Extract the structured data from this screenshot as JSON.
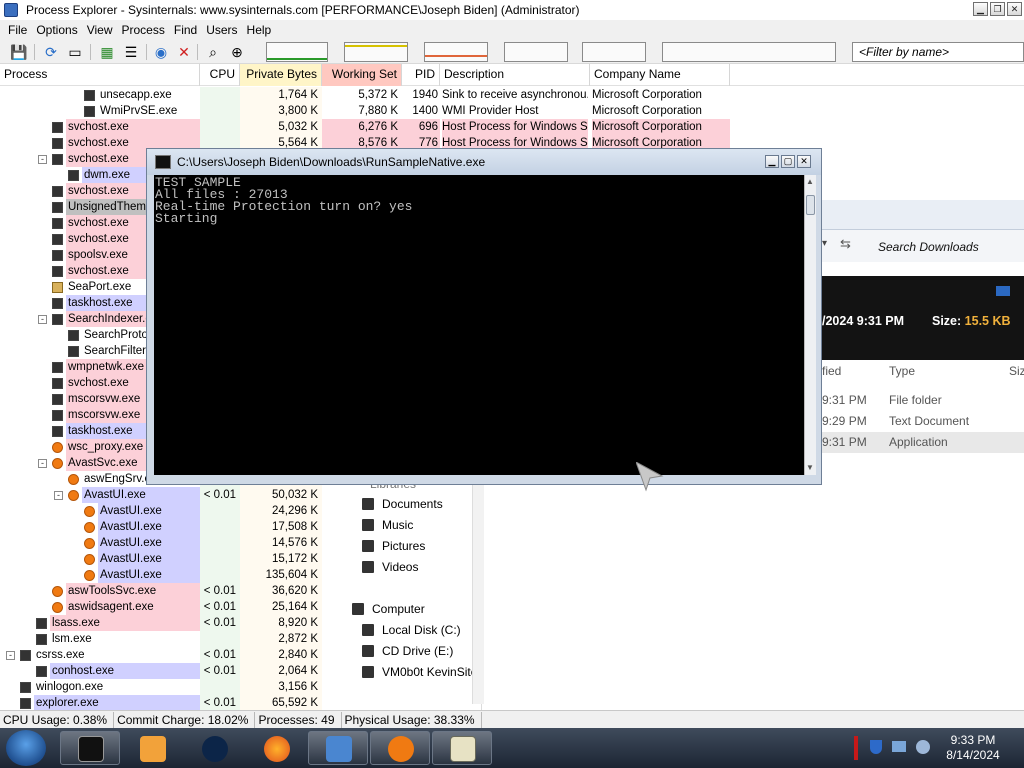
{
  "window": {
    "title": "Process Explorer - Sysinternals: www.sysinternals.com [PERFORMANCE\\Joseph Biden] (Administrator)"
  },
  "menu": [
    "File",
    "Options",
    "View",
    "Process",
    "Find",
    "Users",
    "Help"
  ],
  "toolbar": {
    "filter_placeholder": "<Filter by name>",
    "icons": [
      "save-icon",
      "refresh-icon",
      "window-icon",
      "chart-icon",
      "target-icon",
      "kill-icon",
      "find-icon",
      "crosshair-icon"
    ]
  },
  "columns": [
    "Process",
    "CPU",
    "Private Bytes",
    "Working Set",
    "PID",
    "Description",
    "Company Name"
  ],
  "processes": [
    {
      "name": "unsecapp.exe",
      "cpu": "",
      "pb": "1,764 K",
      "ws": "5,372 K",
      "pid": "1940",
      "desc": "Sink to receive asynchronou...",
      "co": "Microsoft Corporation"
    },
    {
      "name": "WmiPrvSE.exe",
      "cpu": "",
      "pb": "3,800 K",
      "ws": "7,880 K",
      "pid": "1400",
      "desc": "WMI Provider Host",
      "co": "Microsoft Corporation"
    },
    {
      "name": "svchost.exe",
      "cpu": "",
      "pb": "5,032 K",
      "ws": "6,276 K",
      "pid": "696",
      "desc": "Host Process for Windows S...",
      "co": "Microsoft Corporation"
    },
    {
      "name": "svchost.exe",
      "cpu": "",
      "pb": "5,564 K",
      "ws": "8,576 K",
      "pid": "776",
      "desc": "Host Process for Windows S...",
      "co": "Microsoft Corporation"
    },
    {
      "name": "svchost.exe",
      "cpu": "",
      "pb": "",
      "ws": "",
      "pid": "",
      "desc": "",
      "co": ""
    },
    {
      "name": "dwm.exe",
      "cpu": "",
      "pb": "",
      "ws": "",
      "pid": "",
      "desc": "",
      "co": ""
    },
    {
      "name": "svchost.exe",
      "cpu": "",
      "pb": "",
      "ws": "",
      "pid": "",
      "desc": "",
      "co": ""
    },
    {
      "name": "UnsignedThemes",
      "cpu": "",
      "pb": "",
      "ws": "",
      "pid": "",
      "desc": "",
      "co": ""
    },
    {
      "name": "svchost.exe",
      "cpu": "",
      "pb": "",
      "ws": "",
      "pid": "",
      "desc": "",
      "co": ""
    },
    {
      "name": "svchost.exe",
      "cpu": "",
      "pb": "",
      "ws": "",
      "pid": "",
      "desc": "",
      "co": ""
    },
    {
      "name": "spoolsv.exe",
      "cpu": "",
      "pb": "",
      "ws": "",
      "pid": "",
      "desc": "",
      "co": ""
    },
    {
      "name": "svchost.exe",
      "cpu": "",
      "pb": "",
      "ws": "",
      "pid": "",
      "desc": "",
      "co": ""
    },
    {
      "name": "SeaPort.exe",
      "cpu": "",
      "pb": "",
      "ws": "",
      "pid": "",
      "desc": "",
      "co": ""
    },
    {
      "name": "taskhost.exe",
      "cpu": "",
      "pb": "",
      "ws": "",
      "pid": "",
      "desc": "",
      "co": ""
    },
    {
      "name": "SearchIndexer.exe",
      "cpu": "",
      "pb": "",
      "ws": "",
      "pid": "",
      "desc": "",
      "co": ""
    },
    {
      "name": "SearchProtocolHost",
      "cpu": "",
      "pb": "",
      "ws": "",
      "pid": "",
      "desc": "",
      "co": ""
    },
    {
      "name": "SearchFilterHost",
      "cpu": "",
      "pb": "",
      "ws": "",
      "pid": "",
      "desc": "",
      "co": ""
    },
    {
      "name": "wmpnetwk.exe",
      "cpu": "",
      "pb": "",
      "ws": "",
      "pid": "",
      "desc": "",
      "co": ""
    },
    {
      "name": "svchost.exe",
      "cpu": "",
      "pb": "",
      "ws": "",
      "pid": "",
      "desc": "",
      "co": ""
    },
    {
      "name": "mscorsvw.exe",
      "cpu": "",
      "pb": "",
      "ws": "",
      "pid": "",
      "desc": "",
      "co": ""
    },
    {
      "name": "mscorsvw.exe",
      "cpu": "",
      "pb": "",
      "ws": "",
      "pid": "",
      "desc": "",
      "co": ""
    },
    {
      "name": "taskhost.exe",
      "cpu": "",
      "pb": "",
      "ws": "",
      "pid": "",
      "desc": "",
      "co": ""
    },
    {
      "name": "wsc_proxy.exe",
      "cpu": "",
      "pb": "",
      "ws": "",
      "pid": "",
      "desc": "",
      "co": ""
    },
    {
      "name": "AvastSvc.exe",
      "cpu": "",
      "pb": "",
      "ws": "",
      "pid": "",
      "desc": "",
      "co": ""
    },
    {
      "name": "aswEngSrv.exe",
      "cpu": "",
      "pb": "",
      "ws": "",
      "pid": "",
      "desc": "",
      "co": ""
    },
    {
      "name": "AvastUI.exe",
      "cpu": "< 0.01",
      "pb": "50,032 K",
      "ws": "",
      "pid": "",
      "desc": "",
      "co": ""
    },
    {
      "name": "AvastUI.exe",
      "cpu": "",
      "pb": "24,296 K",
      "ws": "",
      "pid": "",
      "desc": "",
      "co": ""
    },
    {
      "name": "AvastUI.exe",
      "cpu": "",
      "pb": "17,508 K",
      "ws": "",
      "pid": "",
      "desc": "",
      "co": ""
    },
    {
      "name": "AvastUI.exe",
      "cpu": "",
      "pb": "14,576 K",
      "ws": "",
      "pid": "",
      "desc": "",
      "co": ""
    },
    {
      "name": "AvastUI.exe",
      "cpu": "",
      "pb": "15,172 K",
      "ws": "",
      "pid": "",
      "desc": "",
      "co": ""
    },
    {
      "name": "AvastUI.exe",
      "cpu": "",
      "pb": "135,604 K",
      "ws": "",
      "pid": "",
      "desc": "",
      "co": ""
    },
    {
      "name": "aswToolsSvc.exe",
      "cpu": "< 0.01",
      "pb": "36,620 K",
      "ws": "",
      "pid": "",
      "desc": "",
      "co": ""
    },
    {
      "name": "aswidsagent.exe",
      "cpu": "< 0.01",
      "pb": "25,164 K",
      "ws": "",
      "pid": "",
      "desc": "",
      "co": ""
    },
    {
      "name": "lsass.exe",
      "cpu": "< 0.01",
      "pb": "8,920 K",
      "ws": "",
      "pid": "",
      "desc": "",
      "co": ""
    },
    {
      "name": "lsm.exe",
      "cpu": "",
      "pb": "2,872 K",
      "ws": "",
      "pid": "",
      "desc": "",
      "co": ""
    },
    {
      "name": "csrss.exe",
      "cpu": "< 0.01",
      "pb": "2,840 K",
      "ws": "",
      "pid": "",
      "desc": "",
      "co": ""
    },
    {
      "name": "conhost.exe",
      "cpu": "< 0.01",
      "pb": "2,064 K",
      "ws": "",
      "pid": "",
      "desc": "",
      "co": ""
    },
    {
      "name": "winlogon.exe",
      "cpu": "",
      "pb": "3,156 K",
      "ws": "",
      "pid": "",
      "desc": "",
      "co": ""
    },
    {
      "name": "explorer.exe",
      "cpu": "< 0.01",
      "pb": "65,592 K",
      "ws": "",
      "pid": "",
      "desc": "",
      "co": ""
    }
  ],
  "status": {
    "cpu": "CPU Usage: 0.38%",
    "commit": "Commit Charge: 18.02%",
    "processes": "Processes: 49",
    "physical": "Physical Usage: 38.33%"
  },
  "explorer": {
    "search": "Search Downloads",
    "detail_date": "/2024 9:31 PM",
    "detail_size_label": "Size:",
    "detail_size_value": "15.5 KB",
    "col_modified": "fied",
    "col_type": "Type",
    "col_size": "Siz",
    "files": [
      {
        "time": "9:31 PM",
        "type": "File folder"
      },
      {
        "time": "9:29 PM",
        "type": "Text Document"
      },
      {
        "time": "9:31 PM",
        "type": "Application"
      }
    ],
    "nav": [
      "Libraries",
      "Documents",
      "Music",
      "Pictures",
      "Videos",
      "Computer",
      "Local Disk (C:)",
      "CD Drive (E:)",
      "VM0b0t KevinSite"
    ]
  },
  "console": {
    "title": "C:\\Users\\Joseph Biden\\Downloads\\RunSampleNative.exe",
    "lines": [
      "TEST SAMPLE",
      "All files : 27013",
      "Real-time Protection turn on? yes",
      "Starting"
    ]
  },
  "taskbar": {
    "time": "9:33 PM",
    "date": "8/14/2024"
  },
  "colors": {
    "service_pink": "#fcd0d8",
    "own_blue": "#d0d0ff",
    "private_bytes_header": "#fff5c8",
    "working_set_header": "#ffc8c0"
  }
}
